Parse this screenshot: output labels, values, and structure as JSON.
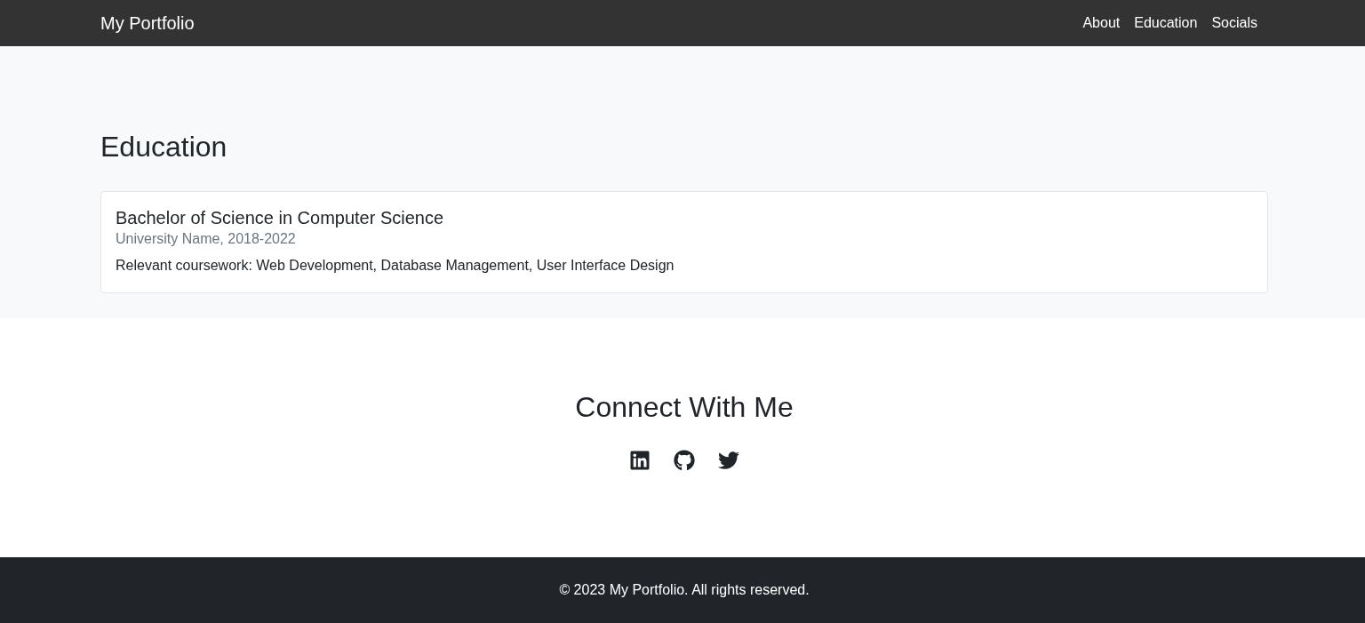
{
  "navbar": {
    "brand": "My Portfolio",
    "links": [
      "About",
      "Education",
      "Socials"
    ]
  },
  "education": {
    "heading": "Education",
    "entries": [
      {
        "title": "Bachelor of Science in Computer Science",
        "subtitle": "University Name, 2018-2022",
        "text": "Relevant coursework: Web Development, Database Management, User Interface Design"
      }
    ]
  },
  "socials": {
    "heading": "Connect With Me"
  },
  "footer": {
    "text": "© 2023 My Portfolio. All rights reserved."
  }
}
